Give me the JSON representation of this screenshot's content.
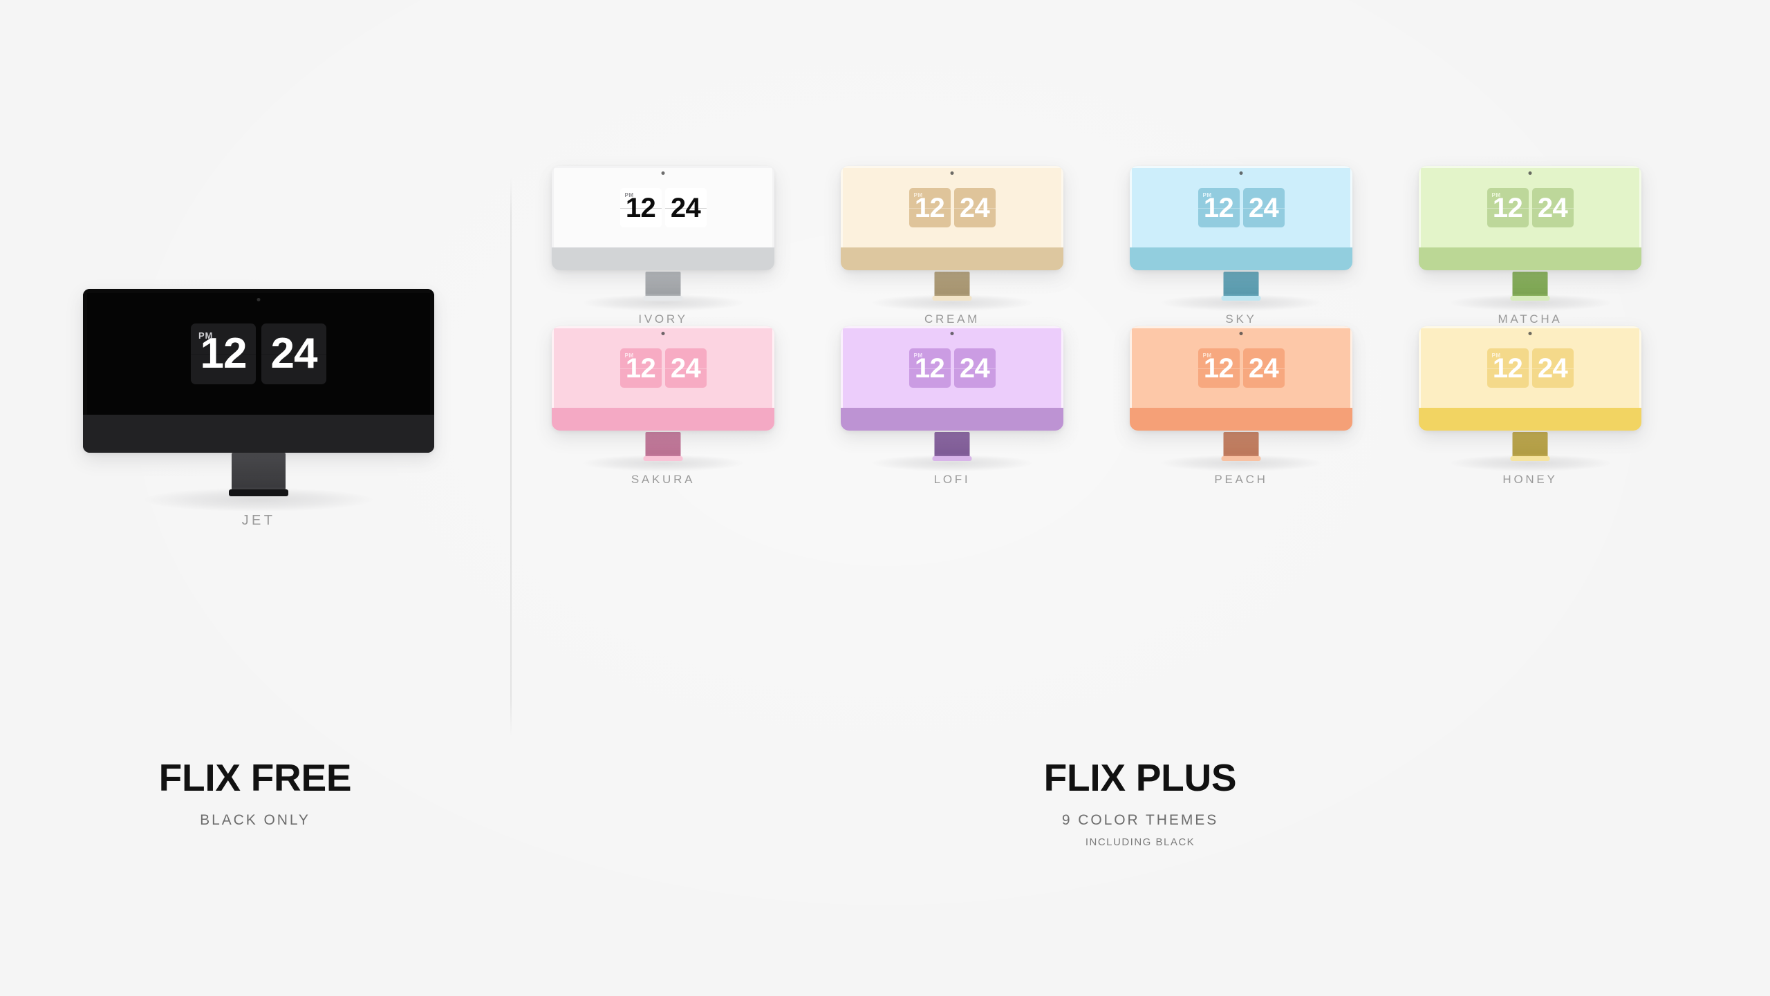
{
  "background_color": "#f5f5f5",
  "clock": {
    "hours": "12",
    "minutes": "24",
    "meridiem": "PM"
  },
  "free_section": {
    "title": "FLIX FREE",
    "subtitle": "BLACK ONLY",
    "theme": {
      "name": "JET",
      "screen_bg": "#050505",
      "chin": "#222224",
      "card_bg": "#1d1d1f",
      "digit_color": "#ffffff",
      "pm_color": "#cfcfd2",
      "neck_top": "#4a4a4d",
      "neck_bottom": "#3a3a3d",
      "foot": "#141416",
      "bezel": "#0a0a0a"
    }
  },
  "plus_section": {
    "title": "FLIX PLUS",
    "subtitle": "9 COLOR THEMES",
    "subtitle2": "INCLUDING BLACK",
    "themes": [
      {
        "name": "IVORY",
        "screen_bg": "#fbfbfb",
        "chin": "#d2d4d6",
        "card_bg": "#ffffff",
        "digit_color": "#0c0c0c",
        "pm_color": "#8a8a8e",
        "neck_top": "#b6b9bc",
        "neck_bottom": "#9ea1a5",
        "foot": "#e6e8ea",
        "bezel": "#f3f3f4",
        "light_cards": false
      },
      {
        "name": "CREAM",
        "screen_bg": "#fcf1dd",
        "chin": "#ddc79f",
        "card_bg": "#dfc49a",
        "digit_color": "#ffffff",
        "pm_color": "#f7ecda",
        "neck_top": "#b7a57f",
        "neck_bottom": "#a69470",
        "foot": "#f2e4c8",
        "bezel": "#fdf8ee",
        "light_cards": true
      },
      {
        "name": "SKY",
        "screen_bg": "#cdeefb",
        "chin": "#92cede",
        "card_bg": "#92ccdf",
        "digit_color": "#ffffff",
        "pm_color": "#e4f5fb",
        "neck_top": "#69aabd",
        "neck_bottom": "#5b9bae",
        "foot": "#bfe6f1",
        "bezel": "#f1fafd",
        "light_cards": true
      },
      {
        "name": "MATCHA",
        "screen_bg": "#e3f4c9",
        "chin": "#bbd795",
        "card_bg": "#bdd79a",
        "digit_color": "#ffffff",
        "pm_color": "#eef8dd",
        "neck_top": "#8db560",
        "neck_bottom": "#7da553",
        "foot": "#d7ecbb",
        "bezel": "#f4fbe9",
        "light_cards": true
      },
      {
        "name": "SAKURA",
        "screen_bg": "#fcd4e1",
        "chin": "#f4a9c4",
        "card_bg": "#f7abc3",
        "digit_color": "#ffffff",
        "pm_color": "#fde6ee",
        "neck_top": "#c97fa0",
        "neck_bottom": "#bb7293",
        "foot": "#f9c3d6",
        "bezel": "#fef1f5",
        "light_cards": true
      },
      {
        "name": "LOFI",
        "screen_bg": "#eccdfb",
        "chin": "#bd93d3",
        "card_bg": "#cb9ce3",
        "digit_color": "#ffffff",
        "pm_color": "#f3e2fb",
        "neck_top": "#8f6aa6",
        "neck_bottom": "#7f5c96",
        "foot": "#d8b4e9",
        "bezel": "#faf0fd",
        "light_cards": true
      },
      {
        "name": "PEACH",
        "screen_bg": "#fdc8a8",
        "chin": "#f5a077",
        "card_bg": "#f7a87f",
        "digit_color": "#ffffff",
        "pm_color": "#fde3d1",
        "neck_top": "#cb8668",
        "neck_bottom": "#bd795c",
        "foot": "#f8c1a2",
        "bezel": "#fef0e6",
        "light_cards": true
      },
      {
        "name": "HONEY",
        "screen_bg": "#fdeec2",
        "chin": "#f2d462",
        "card_bg": "#f4d98a",
        "digit_color": "#ffffff",
        "pm_color": "#fdf3da",
        "neck_top": "#c2ac4f",
        "neck_bottom": "#b29d45",
        "foot": "#f6e49f",
        "bezel": "#fef9e8",
        "light_cards": true
      }
    ]
  }
}
